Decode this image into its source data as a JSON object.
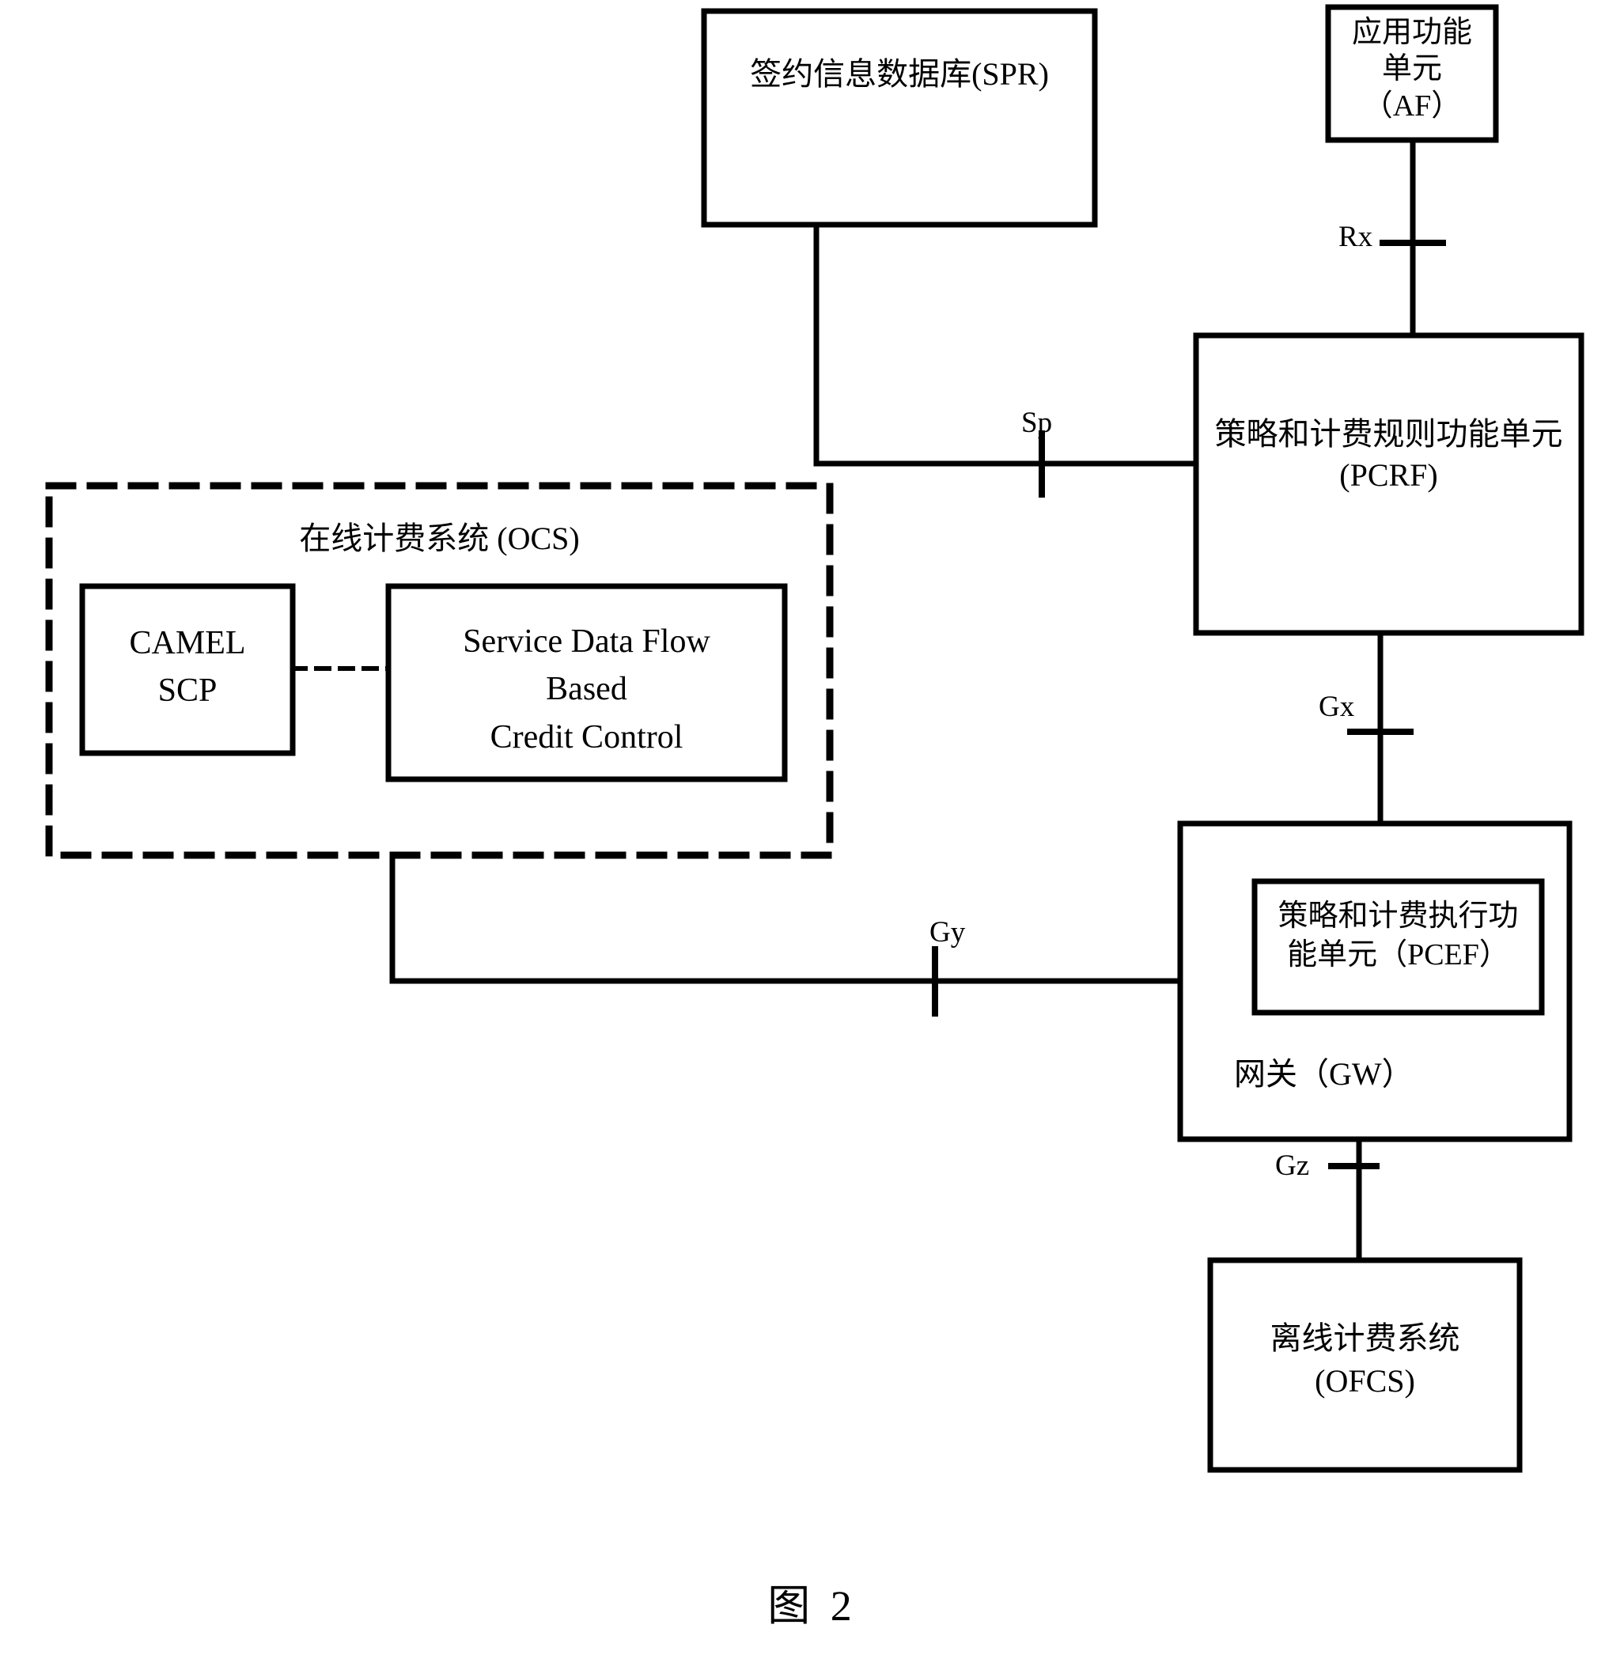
{
  "figure": {
    "caption": "图 2"
  },
  "nodes": {
    "spr": {
      "label": "签约信息数据库(SPR)"
    },
    "af": {
      "label": "应用功能\n单元\n（AF）"
    },
    "pcrf": {
      "label": "策略和计费规则功能单元\n(PCRF)"
    },
    "ocs": {
      "label": "在线计费系统 (OCS)"
    },
    "camel_scp": {
      "label": "CAMEL\nSCP"
    },
    "sdf_credit_control": {
      "label": "Service Data Flow\nBased\nCredit Control"
    },
    "gw": {
      "label": "网关（GW）"
    },
    "pcef": {
      "label": "策略和计费执行功\n能单元（PCEF）"
    },
    "ofcs": {
      "label": "离线计费系统\n(OFCS)"
    }
  },
  "interfaces": {
    "rx": {
      "label": "Rx"
    },
    "sp": {
      "label": "Sp"
    },
    "gx": {
      "label": "Gx"
    },
    "gy": {
      "label": "Gy"
    },
    "gz": {
      "label": "Gz"
    }
  },
  "colors": {
    "stroke": "#000000",
    "background": "#ffffff"
  }
}
